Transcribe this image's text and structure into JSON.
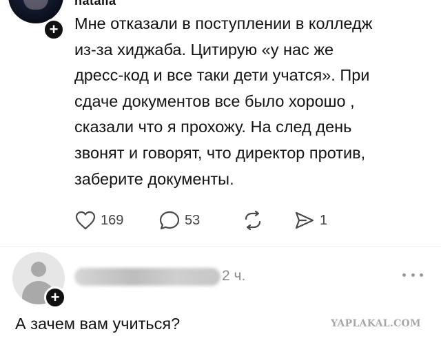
{
  "post": {
    "author": "natalia",
    "text_lines": [
      "Мне отказали в поступлении в колледж",
      "из-за хиджаба. Цитирую «у нас же",
      "дресс-код и все таки дети учатся». При",
      "сдаче документов все было хорошо ,",
      "сказали что я прохожу. На след день",
      "звонят и говорят, что директор против,",
      "заберите документы."
    ],
    "likes": "169",
    "comments": "53",
    "shares": "1"
  },
  "reply": {
    "time": "2 ч.",
    "text": "А зачем вам учиться?"
  },
  "badge_symbol": "+",
  "watermark": "YAPLAKAL.COM",
  "icons": {
    "like": "heart-icon",
    "comment": "speech-bubble-icon",
    "repost": "repost-icon",
    "share": "share-arrow-icon",
    "more": "more-dots-icon",
    "follow": "plus-icon"
  }
}
